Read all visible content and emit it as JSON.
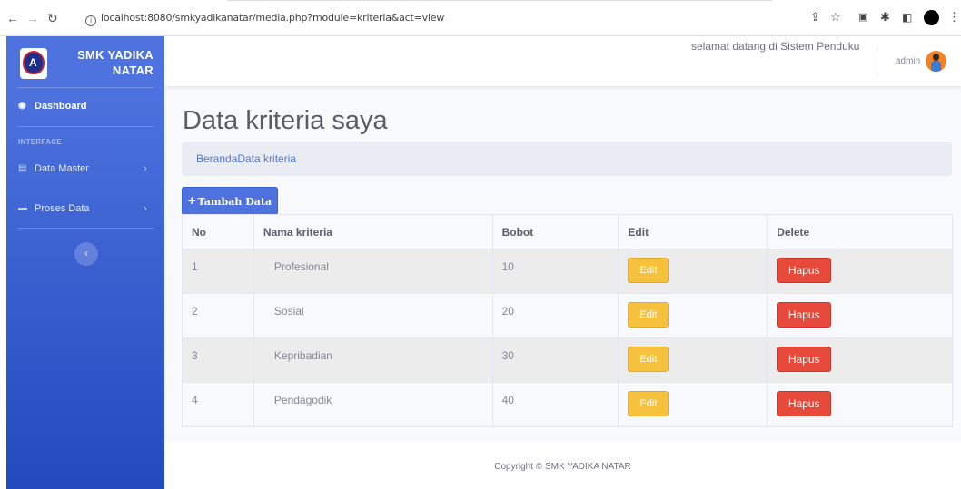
{
  "browser": {
    "url": "localhost:8080/smkyadikanatar/media.php?module=kriteria&act=view"
  },
  "sidebar": {
    "brand": "SMK YADIKA NATAR",
    "dashboard": "Dashboard",
    "heading": "INTERFACE",
    "items": [
      {
        "label": "Data Master"
      },
      {
        "label": "Proses Data"
      }
    ]
  },
  "topbar": {
    "marquee": "selamat datang di Sistem Penduku",
    "user": "admin"
  },
  "page": {
    "title": "Data kriteria saya",
    "breadcrumb": "BerandaData kriteria",
    "add_button": "Tambah Data"
  },
  "table": {
    "columns": [
      "No",
      "Nama kriteria",
      "Bobot",
      "Edit",
      "Delete"
    ],
    "rows": [
      {
        "no": "1",
        "nama": "Profesional",
        "bobot": "10",
        "edit": "Edit",
        "delete": "Hapus"
      },
      {
        "no": "2",
        "nama": "Sosial",
        "bobot": "20",
        "edit": "Edit",
        "delete": "Hapus"
      },
      {
        "no": "3",
        "nama": "Kepribadian",
        "bobot": "30",
        "edit": "Edit",
        "delete": "Hapus"
      },
      {
        "no": "4",
        "nama": "Pendagodik",
        "bobot": "40",
        "edit": "Edit",
        "delete": "Hapus"
      }
    ]
  },
  "footer": {
    "copyright": "Copyright © SMK YADIKA NATAR"
  },
  "colors": {
    "primary": "#4e73df",
    "warning": "#f6c23e",
    "danger": "#e74a3b"
  }
}
